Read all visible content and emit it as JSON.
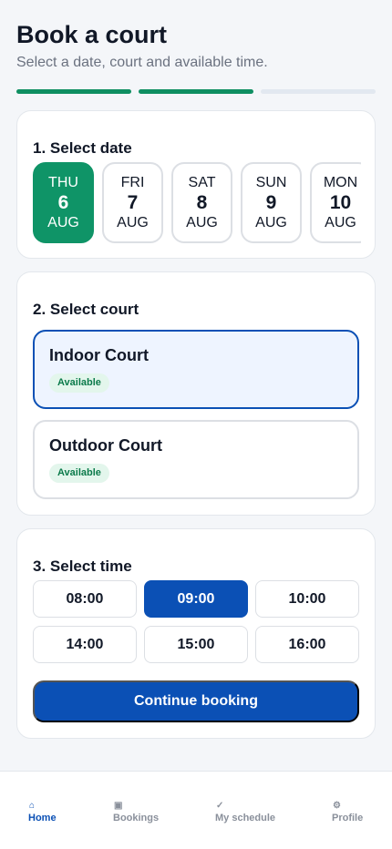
{
  "header": {
    "title": "Book a court",
    "subtitle": "Select a date, court and available time."
  },
  "progress": {
    "steps_total": 3,
    "steps_done": 2
  },
  "date_section": {
    "title": "1. Select date",
    "dates": [
      {
        "dow": "THU",
        "day": "6",
        "month": "AUG",
        "selected": true
      },
      {
        "dow": "FRI",
        "day": "7",
        "month": "AUG",
        "selected": false
      },
      {
        "dow": "SAT",
        "day": "8",
        "month": "AUG",
        "selected": false
      },
      {
        "dow": "SUN",
        "day": "9",
        "month": "AUG",
        "selected": false
      },
      {
        "dow": "MON",
        "day": "10",
        "month": "AUG",
        "selected": false
      }
    ]
  },
  "court_section": {
    "title": "2. Select court",
    "courts": [
      {
        "name": "Indoor Court",
        "status": "Available",
        "selected": true
      },
      {
        "name": "Outdoor Court",
        "status": "Available",
        "selected": false
      }
    ]
  },
  "time_section": {
    "title": "3. Select time",
    "slots": [
      "08:00",
      "09:00",
      "10:00",
      "14:00",
      "15:00",
      "16:00"
    ],
    "selected_slot": "09:00",
    "continue_label": "Continue booking"
  },
  "bottom_nav": {
    "items": [
      {
        "label": "Home",
        "icon": "⌂",
        "icon_name": "home-icon",
        "active": true
      },
      {
        "label": "Bookings",
        "icon": "▣",
        "icon_name": "bookings-icon",
        "active": false
      },
      {
        "label": "My schedule",
        "icon": "✓",
        "icon_name": "check-icon",
        "active": false
      },
      {
        "label": "Profile",
        "icon": "⚙",
        "icon_name": "gear-icon",
        "active": false
      }
    ]
  },
  "colors": {
    "primary": "#0b50b5",
    "success": "#0f9467",
    "background": "#f4f6f9"
  }
}
